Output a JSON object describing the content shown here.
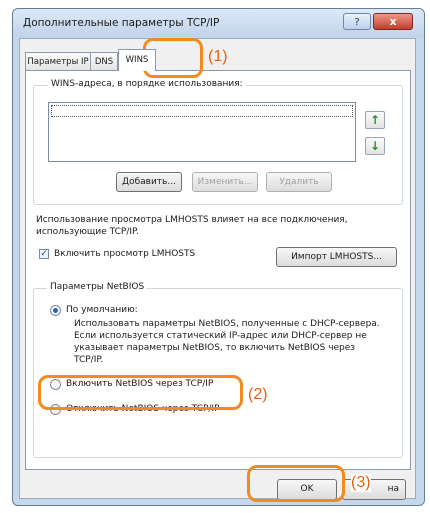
{
  "window": {
    "title": "Дополнительные параметры TCP/IP",
    "help_glyph": "?",
    "close_glyph": "x"
  },
  "tabs": [
    {
      "label": "Параметры IP"
    },
    {
      "label": "DNS"
    },
    {
      "label": "WINS"
    }
  ],
  "wins": {
    "group_label": "WINS-адреса, в порядке использования:",
    "up_glyph": "↑",
    "down_glyph": "↓",
    "add_label": "Добавить...",
    "edit_label": "Изменить...",
    "remove_label": "Удалить"
  },
  "lmhosts": {
    "info_text": "Использование просмотра LMHOSTS влияет на все подключения, использующие TCP/IP.",
    "enable_label": "Включить просмотр LMHOSTS",
    "enable_checked": true,
    "import_label": "Импорт LMHOSTS..."
  },
  "netbios": {
    "group_label": "Параметры NetBIOS",
    "default_label": "По умолчанию:",
    "default_desc": "Использовать параметры NetBIOS, полученные с DHCP-сервера. Если используется статический IP-адрес или DHCP-сервер не указывает параметры NetBIOS, то включить NetBIOS через TCP/IP.",
    "enable_label": "Включить NetBIOS через TCP/IP",
    "disable_label": "Отключить NetBIOS через TCP/IP",
    "selected": "default"
  },
  "footer": {
    "ok_label": "OK",
    "cancel_label": "на"
  },
  "callouts": [
    "(1)",
    "(2)",
    "(3)"
  ],
  "colors": {
    "highlight": "#f28a1c",
    "callout_text": "#e8600f"
  }
}
